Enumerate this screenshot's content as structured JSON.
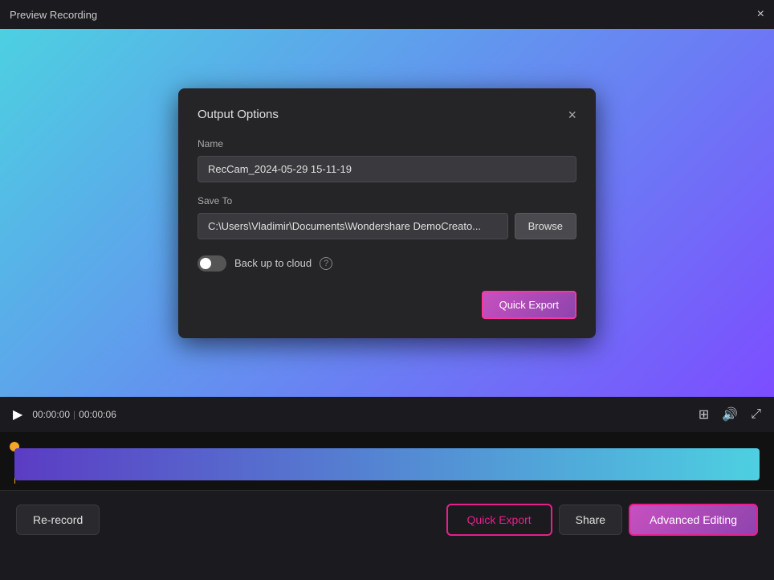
{
  "window": {
    "title": "Preview Recording",
    "close_icon": "×"
  },
  "dialog": {
    "title": "Output Options",
    "close_icon": "×",
    "name_label": "Name",
    "name_value": "RecCam_2024-05-29 15-11-19",
    "save_to_label": "Save To",
    "save_to_value": "C:\\Users\\Vladimir\\Documents\\Wondershare DemoCreato...",
    "browse_label": "Browse",
    "cloud_label": "Back up to cloud",
    "quick_export_label": "Quick Export"
  },
  "controls": {
    "play_icon": "▶",
    "time_current": "00:00:00",
    "time_separator": "|",
    "time_total": "00:00:06",
    "fullscreen_icon": "⛶",
    "volume_icon": "🔊",
    "layout_icon": "⊞"
  },
  "bottom_bar": {
    "re_record_label": "Re-record",
    "quick_export_label": "Quick Export",
    "share_label": "Share",
    "advanced_editing_label": "Advanced Editing"
  }
}
